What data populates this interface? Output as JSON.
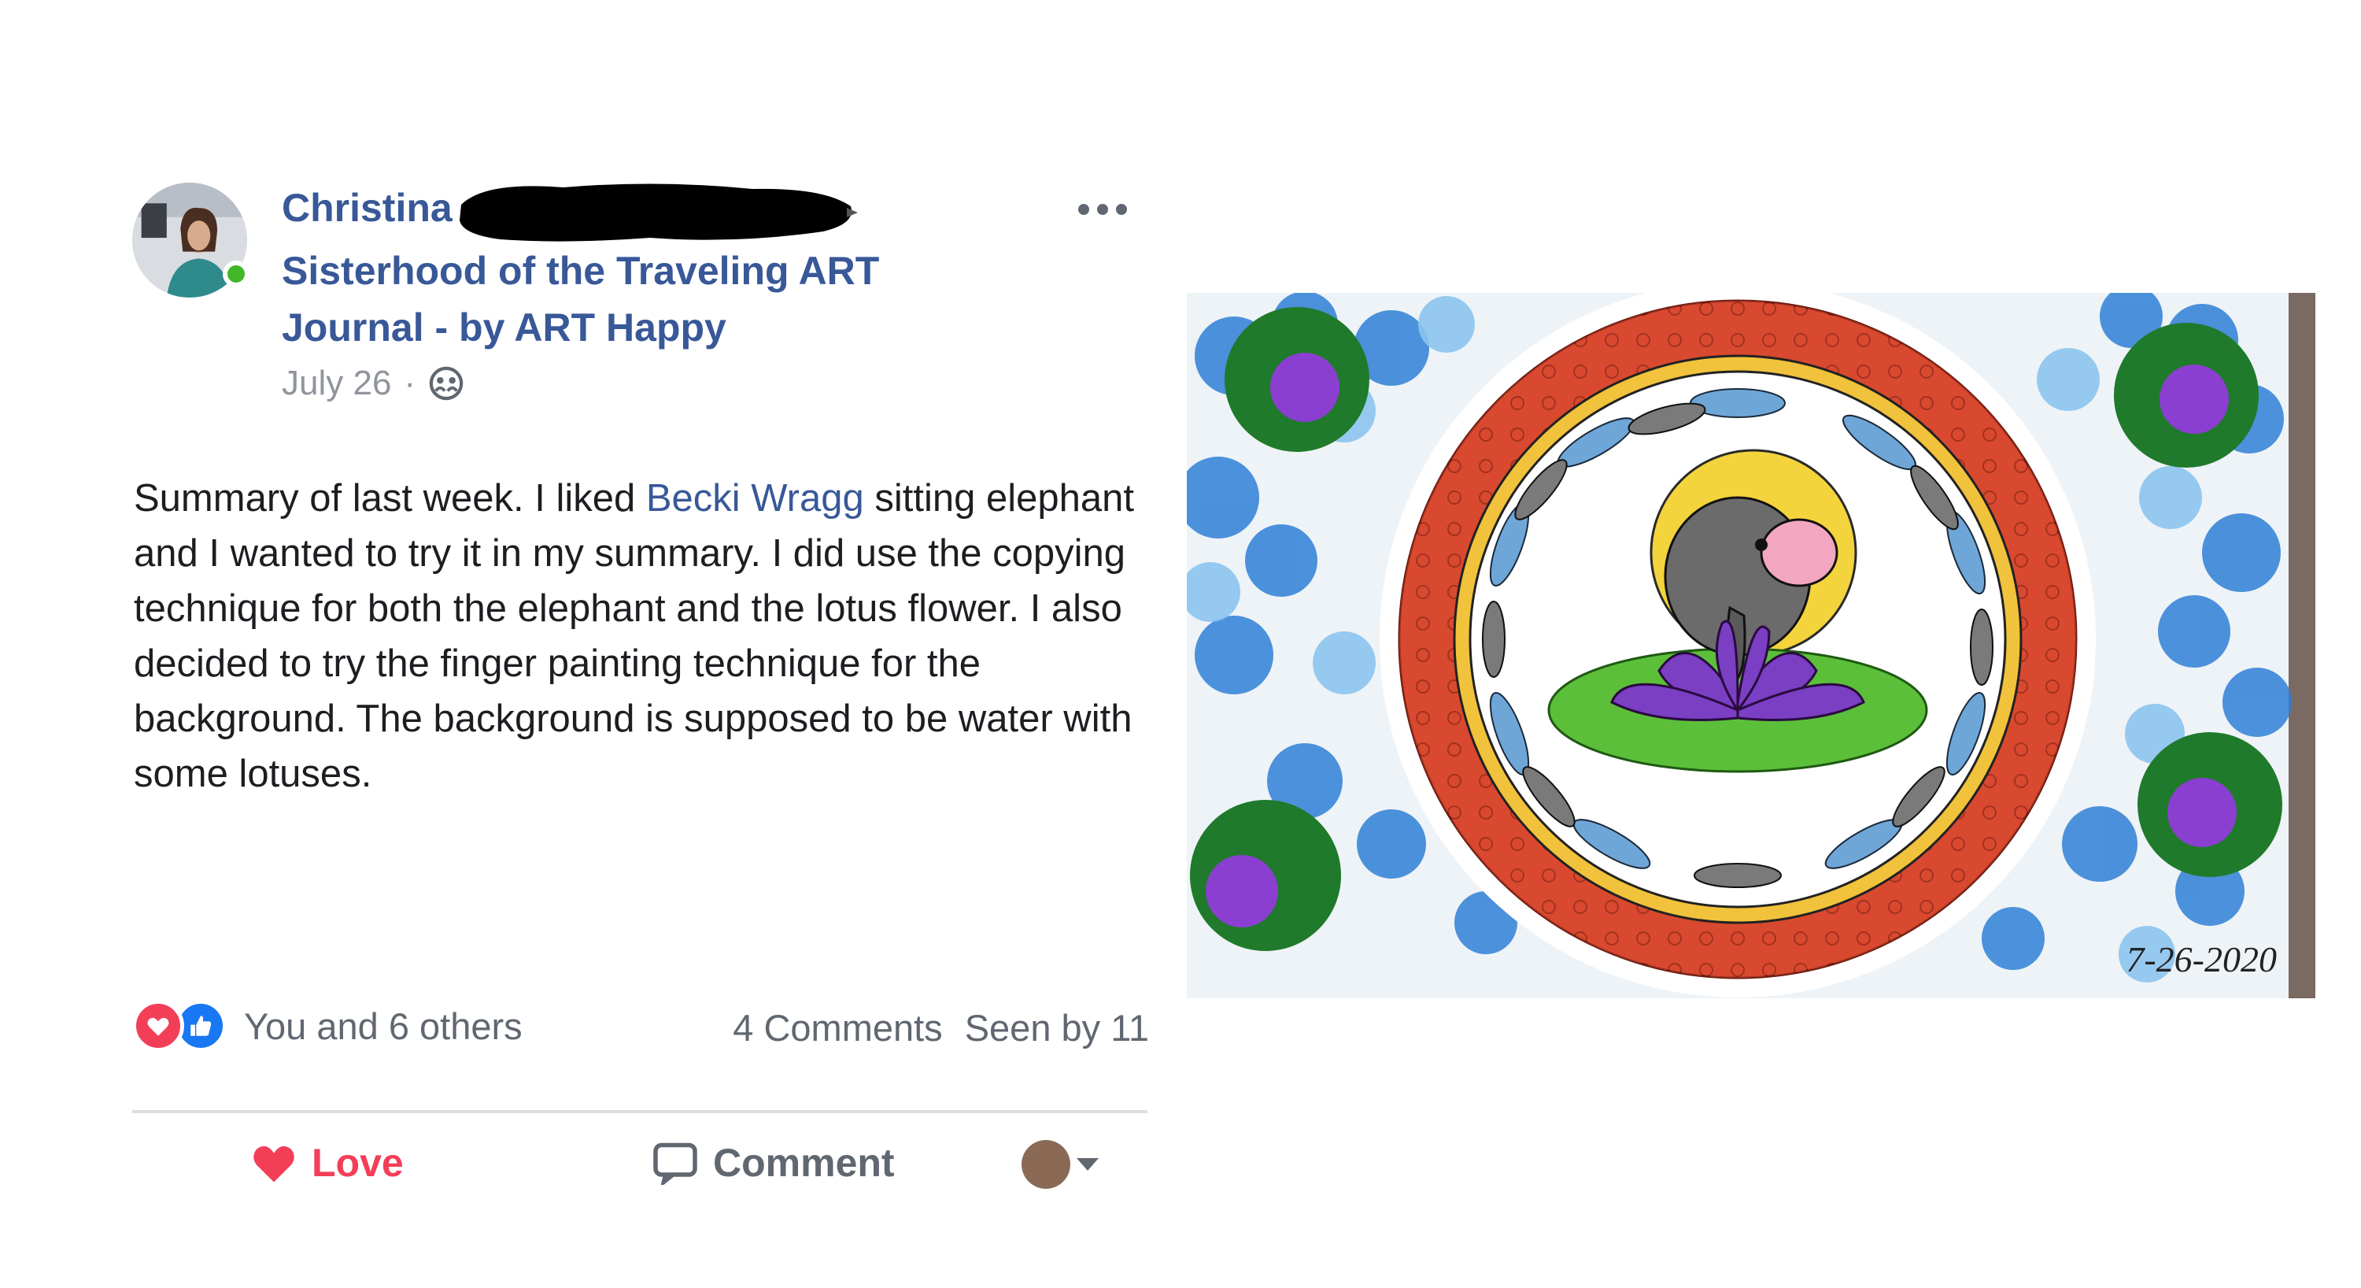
{
  "post": {
    "author_name": "Christina",
    "group_name": "Sisterhood of the Traveling ART Journal - by ART Happy",
    "date": "July 26",
    "meta_separator": "·",
    "body_before_mention": "Summary of last week. I liked ",
    "mention": "Becki Wragg",
    "body_after_mention": " sitting elephant and I wanted to try it in my summary. I did use the copying technique for both the elephant and the lotus flower. I also decided to try the finger painting technique for the background. The background is supposed to be water with some lotuses.",
    "reactions_text": "You and 6 others",
    "comments_count": "4 Comments",
    "seen_by": "Seen by 11",
    "love_label": "Love",
    "comment_label": "Comment"
  },
  "artwork": {
    "date_signature": "7-26-2020"
  },
  "colors": {
    "link_blue": "#385898",
    "text": "#1c1e21",
    "secondary": "#606770",
    "love_red": "#f33e58",
    "like_blue": "#1877f2",
    "online_green": "#42b72a"
  },
  "icons": [
    "more-options-icon",
    "globe-icon",
    "love-reaction-icon",
    "like-reaction-icon",
    "love-button-icon",
    "comment-icon",
    "audience-caret-icon"
  ]
}
